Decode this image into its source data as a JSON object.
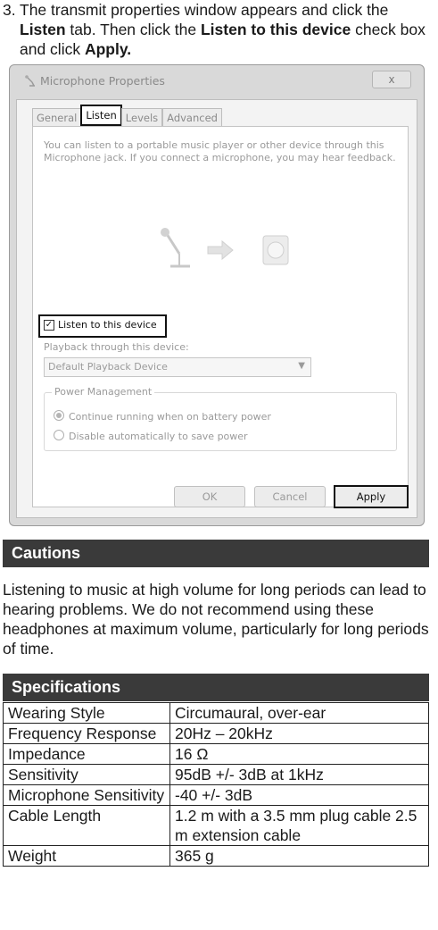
{
  "step": {
    "number": "3.",
    "t1": "The transmit properties window appears and click the ",
    "b1": "Listen",
    "t2": " tab. Then click the ",
    "b2": "Listen to this device",
    "t3": " check box and click ",
    "b3": "Apply."
  },
  "dialog": {
    "title": "Microphone Properties",
    "close": "x",
    "tabs": [
      "General",
      "Listen",
      "Levels",
      "Advanced"
    ],
    "description": "You can listen to a portable music player or other device through this Microphone jack.  If you connect a microphone, you may hear feedback.",
    "listen_checkbox": "Listen to this device",
    "playback_label": "Playback through this device:",
    "playback_value": "Default Playback Device",
    "power_group": "Power Management",
    "radio_continue": "Continue running when on battery power",
    "radio_disable": "Disable automatically to save power",
    "ok": "OK",
    "cancel": "Cancel",
    "apply": "Apply"
  },
  "cautions": {
    "heading": "Cautions",
    "text": "Listening to music at high volume for long periods can lead to hearing problems. We do not recommend using these headphones at maximum volume, particularly for long periods of time."
  },
  "specs": {
    "heading": "Specifications",
    "rows": [
      {
        "k": "Wearing Style",
        "v": "Circumaural, over-ear"
      },
      {
        "k": "Frequency Response",
        "v": "20Hz – 20kHz"
      },
      {
        "k": "Impedance",
        "v": "16 Ω"
      },
      {
        "k": "Sensitivity",
        "v": "95dB +/- 3dB at 1kHz"
      },
      {
        "k": "Microphone Sensitivity",
        "v": "-40 +/- 3dB"
      },
      {
        "k": "Cable Length",
        "v": "1.2 m with a 3.5 mm plug cable 2.5 m extension cable"
      },
      {
        "k": "Weight",
        "v": "365 g"
      }
    ]
  }
}
